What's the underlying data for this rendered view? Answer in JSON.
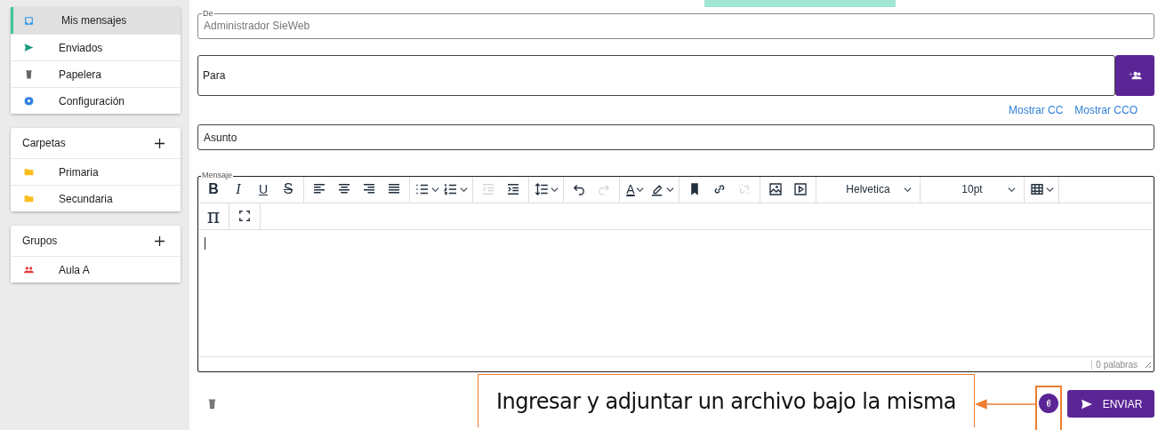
{
  "sidebar": {
    "nav": [
      {
        "label": "Mis mensajes",
        "selected": true
      },
      {
        "label": "Enviados",
        "selected": false
      },
      {
        "label": "Papelera",
        "selected": false
      },
      {
        "label": "Configuración",
        "selected": false
      }
    ],
    "sections": [
      {
        "title": "Carpetas",
        "items": [
          {
            "label": "Primaria"
          },
          {
            "label": "Secundaria"
          }
        ]
      },
      {
        "title": "Grupos",
        "items": [
          {
            "label": "Aula A"
          }
        ]
      }
    ]
  },
  "form": {
    "from": {
      "label": "De",
      "value": "Administrador SieWeb"
    },
    "to": {
      "placeholder": "Para"
    },
    "cc_links": [
      "Mostrar CC",
      "Mostrar CCO"
    ],
    "subject": {
      "placeholder": "Asunto"
    },
    "message": {
      "label": "Mensaje",
      "word_count": "0 palabras"
    }
  },
  "toolbar": [
    [
      [
        {
          "kind": "bold",
          "text": "B"
        },
        {
          "kind": "italic",
          "text": "I"
        },
        {
          "kind": "underline",
          "text": "U"
        },
        {
          "kind": "strike",
          "text": "S"
        }
      ],
      [
        {
          "kind": "icon",
          "caret": false,
          "disabled": false
        },
        {
          "kind": "icon",
          "caret": false,
          "disabled": false
        },
        {
          "kind": "icon",
          "caret": false,
          "disabled": false
        },
        {
          "kind": "icon",
          "caret": false,
          "disabled": false
        }
      ],
      [
        {
          "kind": "icon",
          "caret": true,
          "disabled": false
        },
        {
          "kind": "icon",
          "caret": true,
          "disabled": false
        }
      ],
      [
        {
          "kind": "icon",
          "caret": false,
          "disabled": true
        },
        {
          "kind": "icon",
          "caret": false,
          "disabled": false
        }
      ],
      [
        {
          "kind": "icon",
          "caret": true,
          "disabled": false
        }
      ],
      [
        {
          "kind": "icon",
          "caret": false,
          "disabled": false
        },
        {
          "kind": "icon",
          "caret": false,
          "disabled": true
        }
      ],
      [
        {
          "kind": "color",
          "text": "A",
          "caret": true
        },
        {
          "kind": "icon",
          "caret": true,
          "disabled": false
        }
      ],
      [
        {
          "kind": "icon",
          "caret": false,
          "disabled": false
        },
        {
          "kind": "icon",
          "caret": false,
          "disabled": false
        },
        {
          "kind": "icon",
          "caret": false,
          "disabled": true
        }
      ],
      [
        {
          "kind": "icon",
          "caret": false,
          "disabled": false
        },
        {
          "kind": "icon",
          "caret": false,
          "disabled": false
        }
      ],
      [
        {
          "kind": "dropdown",
          "text": "Helvetica"
        }
      ],
      [
        {
          "kind": "dropdown",
          "text": "10pt"
        }
      ],
      [
        {
          "kind": "icon",
          "caret": true,
          "disabled": false
        }
      ]
    ],
    [
      [
        {
          "kind": "symbol",
          "text": "π"
        }
      ],
      [
        {
          "kind": "icon",
          "caret": false,
          "disabled": false
        }
      ]
    ]
  ],
  "actions": {
    "send": "ENVIAR"
  },
  "callout": {
    "text": "Ingresar y adjuntar un archivo bajo la misma"
  }
}
